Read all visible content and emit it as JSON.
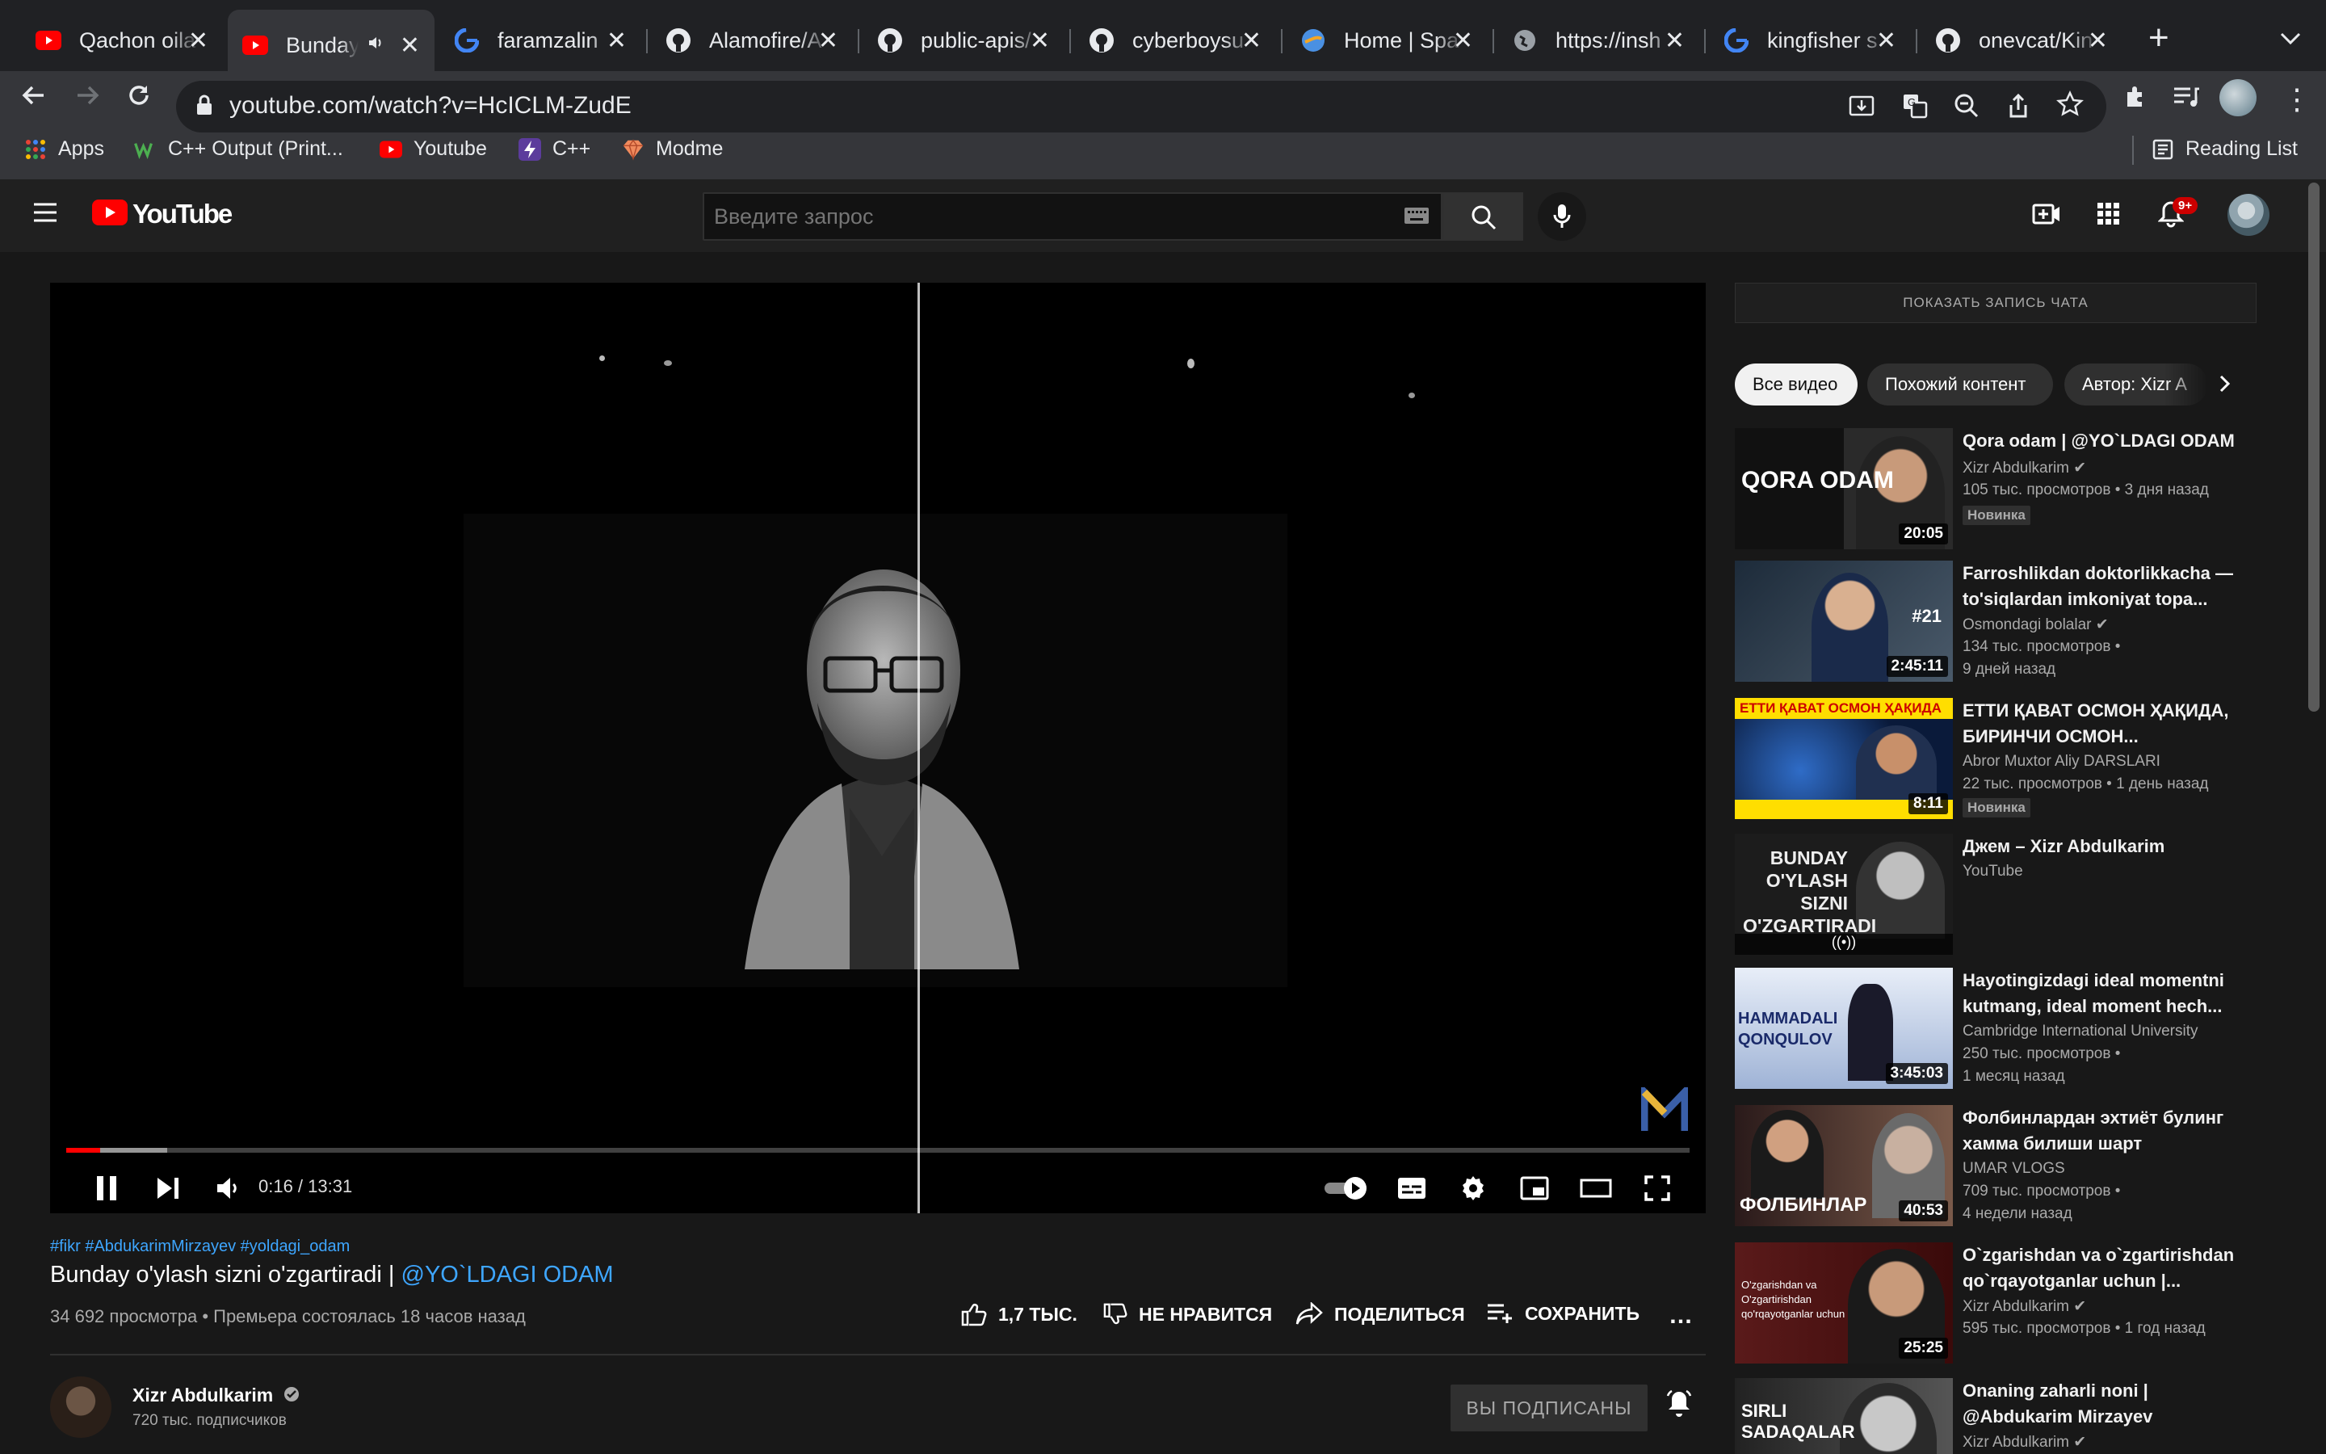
{
  "browser": {
    "tabs": [
      {
        "label": "Qachon oila",
        "icon": "youtube-icon"
      },
      {
        "label": "Bunday",
        "icon": "youtube-icon",
        "active": true,
        "audio": true
      },
      {
        "label": "faramzalin",
        "icon": "google-icon"
      },
      {
        "label": "Alamofire/A",
        "icon": "github-icon"
      },
      {
        "label": "public-apis/",
        "icon": "github-icon"
      },
      {
        "label": "cyberboysu",
        "icon": "github-icon"
      },
      {
        "label": "Home | Spa",
        "icon": "globe-icon"
      },
      {
        "label": "https://insh",
        "icon": "globe-icon"
      },
      {
        "label": "kingfisher s",
        "icon": "google-icon"
      },
      {
        "label": "onevcat/Kin",
        "icon": "github-icon"
      }
    ],
    "url": "youtube.com/watch?v=HcICLM-ZudE",
    "bookmarks": [
      "Apps",
      "C++ Output (Print...",
      "Youtube",
      "C++",
      "Modme"
    ],
    "reading_list": "Reading List"
  },
  "youtube": {
    "logo": "YouTube",
    "search_placeholder": "Введите запрос",
    "notification_count": "9+",
    "colors": {
      "accent": "#ff0000",
      "link": "#3ea6ff"
    }
  },
  "player": {
    "time": "0:16 / 13:31",
    "progress_fraction": 0.02,
    "watermark": "M"
  },
  "video": {
    "tags": "#fikr #AbdukarimMirzayev #yoldagi_odam",
    "title": "Bunday o'ylash sizni o'zgartiradi |",
    "title_handle": "@YO`LDAGI ODAM",
    "views": "34 692 просмотра • Премьера состоялась 18 часов назад",
    "likes": "1,7 ТЫС.",
    "dislike": "НЕ НРАВИТСЯ",
    "share": "ПОДЕЛИТЬСЯ",
    "save": "СОХРАНИТЬ",
    "channel": "Xizr Abdulkarim",
    "subscribers": "720 тыс. подписчиков",
    "subscribed": "ВЫ ПОДПИСАНЫ"
  },
  "sidebar": {
    "chat_button": "ПОКАЗАТЬ ЗАПИСЬ ЧАТА",
    "chips": [
      "Все видео",
      "Похожий контент",
      "Автор: Xizr A"
    ],
    "recommendations": [
      {
        "title": "Qora odam | @YO`LDAGI ODAM",
        "channel": "Xizr Abdulkarim",
        "verified": true,
        "meta": "105 тыс. просмотров • 3 дня назад",
        "meta2": "",
        "badge": "Новинка",
        "duration": "20:05",
        "thumb_text": "QORA ODAM"
      },
      {
        "title": "Farroshlikdan doktorlikkacha — to'siqlardan imkoniyat topa...",
        "channel": "Osmondagi bolalar",
        "verified": true,
        "meta": "134 тыс. просмотров •",
        "meta2": "9 дней назад",
        "badge": "",
        "duration": "2:45:11",
        "thumb_text": "#21"
      },
      {
        "title": "ЕТТИ ҚАВАТ ОСМОН ҲАҚИДА, БИРИНЧИ ОСМОН...",
        "channel": "Abror Muxtor Aliy DARSLARI",
        "verified": false,
        "meta": "22 тыс. просмотров • 1 день назад",
        "meta2": "",
        "badge": "Новинка",
        "duration": "8:11",
        "thumb_text": "ЕТТИ ҚАВАТ ОСМОН ҲАҚИДА"
      },
      {
        "title": "Джем – Xizr Abdulkarim",
        "channel": "YouTube",
        "verified": false,
        "meta": "",
        "meta2": "",
        "badge": "",
        "duration": "",
        "thumb_text": "BUNDAY O'YLASH SIZNI O'ZGARTIRADI"
      },
      {
        "title": "Hayotingizdagi ideal momentni kutmang, ideal moment hech...",
        "channel": "Cambridge International University",
        "verified": false,
        "meta": "250 тыс. просмотров •",
        "meta2": "1 месяц назад",
        "badge": "",
        "duration": "3:45:03",
        "thumb_text": "HAMMADALI QONQULOV"
      },
      {
        "title": "Фолбинлардан эхтиёт булинг хамма билиши шарт",
        "channel": "UMAR VLOGS",
        "verified": false,
        "meta": "709 тыс. просмотров •",
        "meta2": "4 недели назад",
        "badge": "",
        "duration": "40:53",
        "thumb_text": "ФОЛБИНЛАР"
      },
      {
        "title": "O`zgarishdan va o`zgartirishdan qo`rqayotganlar uchun |...",
        "channel": "Xizr Abdulkarim",
        "verified": true,
        "meta": "595 тыс. просмотров • 1 год назад",
        "meta2": "",
        "badge": "",
        "duration": "25:25",
        "thumb_text": "O'zgarishdan va O'zgartirishdan qo'rqayotganlar uchun"
      },
      {
        "title": "Onaning zaharli noni | @Abdukarim Mirzayev",
        "channel": "Xizr Abdulkarim",
        "verified": true,
        "meta": "",
        "meta2": "",
        "badge": "",
        "duration": "",
        "thumb_text": "SIRLI SADAQALAR"
      }
    ]
  }
}
